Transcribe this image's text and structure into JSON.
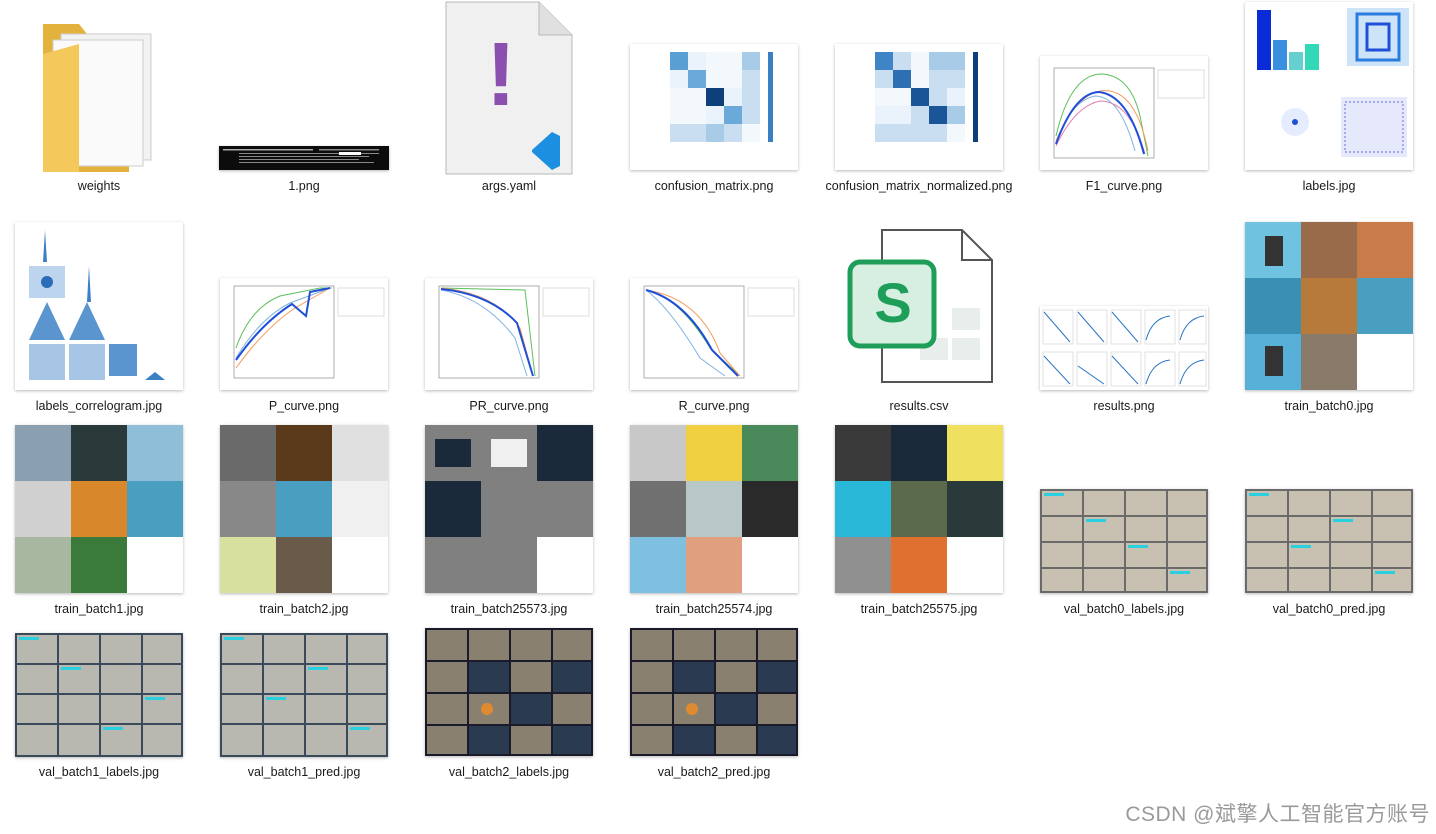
{
  "files": [
    {
      "name": "weights",
      "kind": "folder"
    },
    {
      "name": "1.png",
      "kind": "terminal"
    },
    {
      "name": "args.yaml",
      "kind": "yaml"
    },
    {
      "name": "confusion_matrix.png",
      "kind": "matrix"
    },
    {
      "name": "confusion_matrix_normalized.png",
      "kind": "matrix"
    },
    {
      "name": "F1_curve.png",
      "kind": "curve"
    },
    {
      "name": "labels.jpg",
      "kind": "labels"
    },
    {
      "name": "labels_correlogram.jpg",
      "kind": "correlogram"
    },
    {
      "name": "P_curve.png",
      "kind": "curve"
    },
    {
      "name": "PR_curve.png",
      "kind": "curve"
    },
    {
      "name": "R_curve.png",
      "kind": "curve"
    },
    {
      "name": "results.csv",
      "kind": "csv"
    },
    {
      "name": "results.png",
      "kind": "results"
    },
    {
      "name": "train_batch0.jpg",
      "kind": "mosaic"
    },
    {
      "name": "train_batch1.jpg",
      "kind": "mosaic"
    },
    {
      "name": "train_batch2.jpg",
      "kind": "mosaic"
    },
    {
      "name": "train_batch25573.jpg",
      "kind": "mosaic"
    },
    {
      "name": "train_batch25574.jpg",
      "kind": "mosaic"
    },
    {
      "name": "train_batch25575.jpg",
      "kind": "mosaic"
    },
    {
      "name": "val_batch0_labels.jpg",
      "kind": "valgrid"
    },
    {
      "name": "val_batch0_pred.jpg",
      "kind": "valgrid"
    },
    {
      "name": "val_batch1_labels.jpg",
      "kind": "valgrid"
    },
    {
      "name": "val_batch1_pred.jpg",
      "kind": "valgrid"
    },
    {
      "name": "val_batch2_labels.jpg",
      "kind": "valgrid"
    },
    {
      "name": "val_batch2_pred.jpg",
      "kind": "valgrid"
    }
  ],
  "csv_icon_letter": "S",
  "yaml_icon_glyph": "!",
  "colors": {
    "accent_blue": "#1f4fd8",
    "csv_green": "#1e9e58",
    "yaml_purple": "#8b4fb0",
    "vscode_blue": "#1c8fe0"
  },
  "watermark": "CSDN @斌擎人工智能官方账号"
}
